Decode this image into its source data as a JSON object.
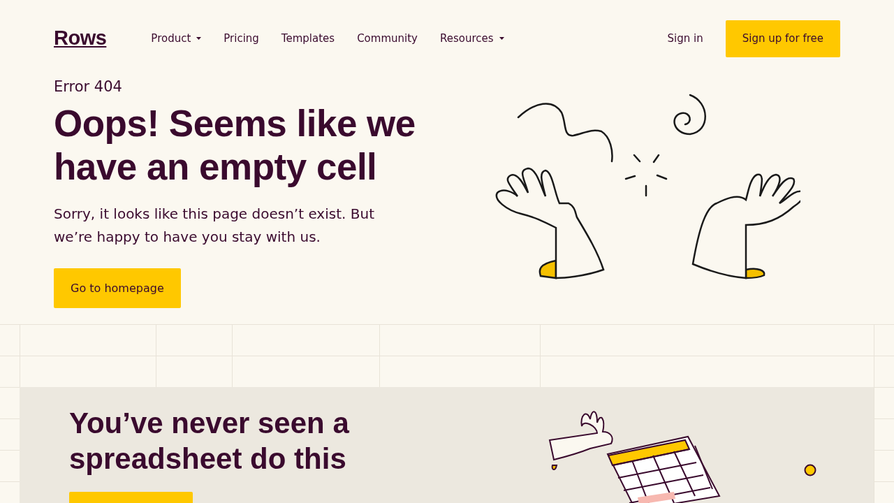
{
  "brand": {
    "logo": "Rows"
  },
  "nav": {
    "items": [
      {
        "label": "Product",
        "has_menu": true
      },
      {
        "label": "Pricing",
        "has_menu": false
      },
      {
        "label": "Templates",
        "has_menu": false
      },
      {
        "label": "Community",
        "has_menu": false
      },
      {
        "label": "Resources",
        "has_menu": true
      }
    ],
    "sign_in": "Sign in",
    "sign_up": "Sign up for free"
  },
  "hero": {
    "eyebrow": "Error 404",
    "title": "Oops! Seems like we have an empty cell",
    "text": "Sorry, it looks like this page doesn’t exist. But we’re happy to have you stay with us.",
    "button": "Go to homepage"
  },
  "promo": {
    "title": "You’ve never seen a spreadsheet do this"
  }
}
